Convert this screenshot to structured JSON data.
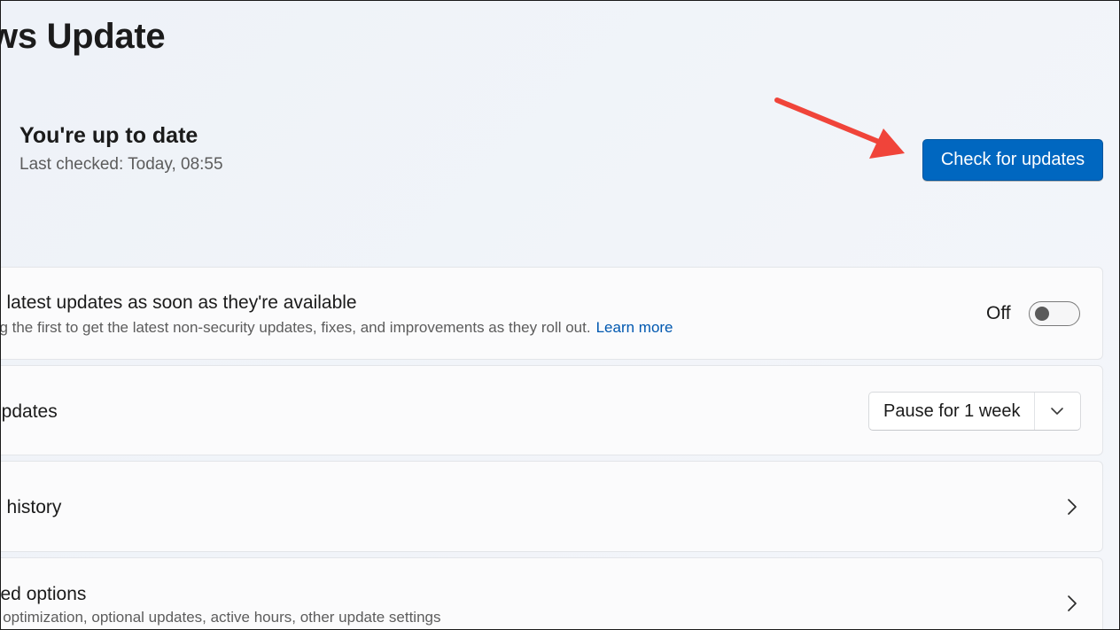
{
  "header": {
    "title": "ws Update"
  },
  "status": {
    "title": "You're up to date",
    "last_checked": "Last checked: Today, 08:55",
    "check_button": "Check for updates"
  },
  "settings": {
    "latest_updates": {
      "title": "e latest updates as soon as they're available",
      "description": "ng the first to get the latest non-security updates, fixes, and improvements as they roll out.",
      "learn_more": "Learn more",
      "toggle_label": "Off",
      "toggle_state": "off"
    },
    "pause_updates": {
      "title": "updates",
      "dropdown_value": "Pause for 1 week"
    },
    "update_history": {
      "title": "e history"
    },
    "advanced_options": {
      "title": "ced options",
      "description": "y optimization, optional updates, active hours, other update settings"
    }
  },
  "colors": {
    "accent": "#0067c0",
    "link": "#0058b0",
    "annotation_arrow": "#f0443a"
  },
  "icons": {
    "arrow": "annotation-arrow",
    "dropdown": "chevron-down-icon",
    "nav": "chevron-right-icon"
  }
}
